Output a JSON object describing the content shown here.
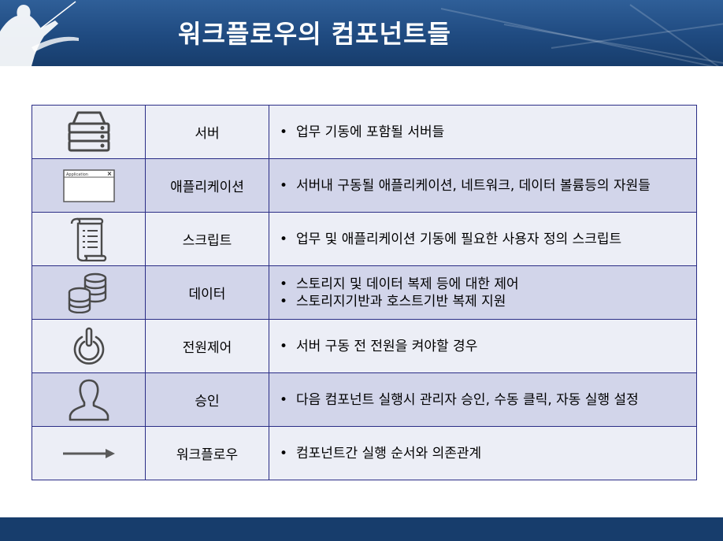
{
  "header": {
    "title": "워크플로우의 컴포넌트들"
  },
  "colors": {
    "header": "#1f4a80",
    "footer": "#173d6c",
    "border": "#2a2d86",
    "row_light": "#eceef6",
    "row_dark": "#d2d5ea"
  },
  "rows": [
    {
      "icon": "server-icon",
      "name": "서버",
      "desc": [
        "업무 기동에 포함될 서버들"
      ]
    },
    {
      "icon": "application-window-icon",
      "icon_text": "Application",
      "name": "애플리케이션",
      "desc": [
        "서버내 구동될 애플리케이션, 네트워크, 데이터 볼륨등의 자원들"
      ]
    },
    {
      "icon": "script-scroll-icon",
      "name": "스크립트",
      "desc": [
        "업무 및 애플리케이션 기동에 필요한 사용자 정의 스크립트"
      ]
    },
    {
      "icon": "database-icon",
      "name": "데이터",
      "desc": [
        "스토리지 및 데이터 복제 등에 대한 제어",
        "스토리지기반과 호스트기반 복제 지원"
      ]
    },
    {
      "icon": "power-icon",
      "name": "전원제어",
      "desc": [
        "서버 구동 전 전원을 켜야할 경우"
      ]
    },
    {
      "icon": "user-icon",
      "name": "승인",
      "desc": [
        "다음 컴포넌트 실행시 관리자 승인, 수동 클릭, 자동 실행 설정"
      ]
    },
    {
      "icon": "arrow-right-icon",
      "name": "워크플로우",
      "desc": [
        "컴포넌트간 실행 순서와 의존관계"
      ]
    }
  ]
}
